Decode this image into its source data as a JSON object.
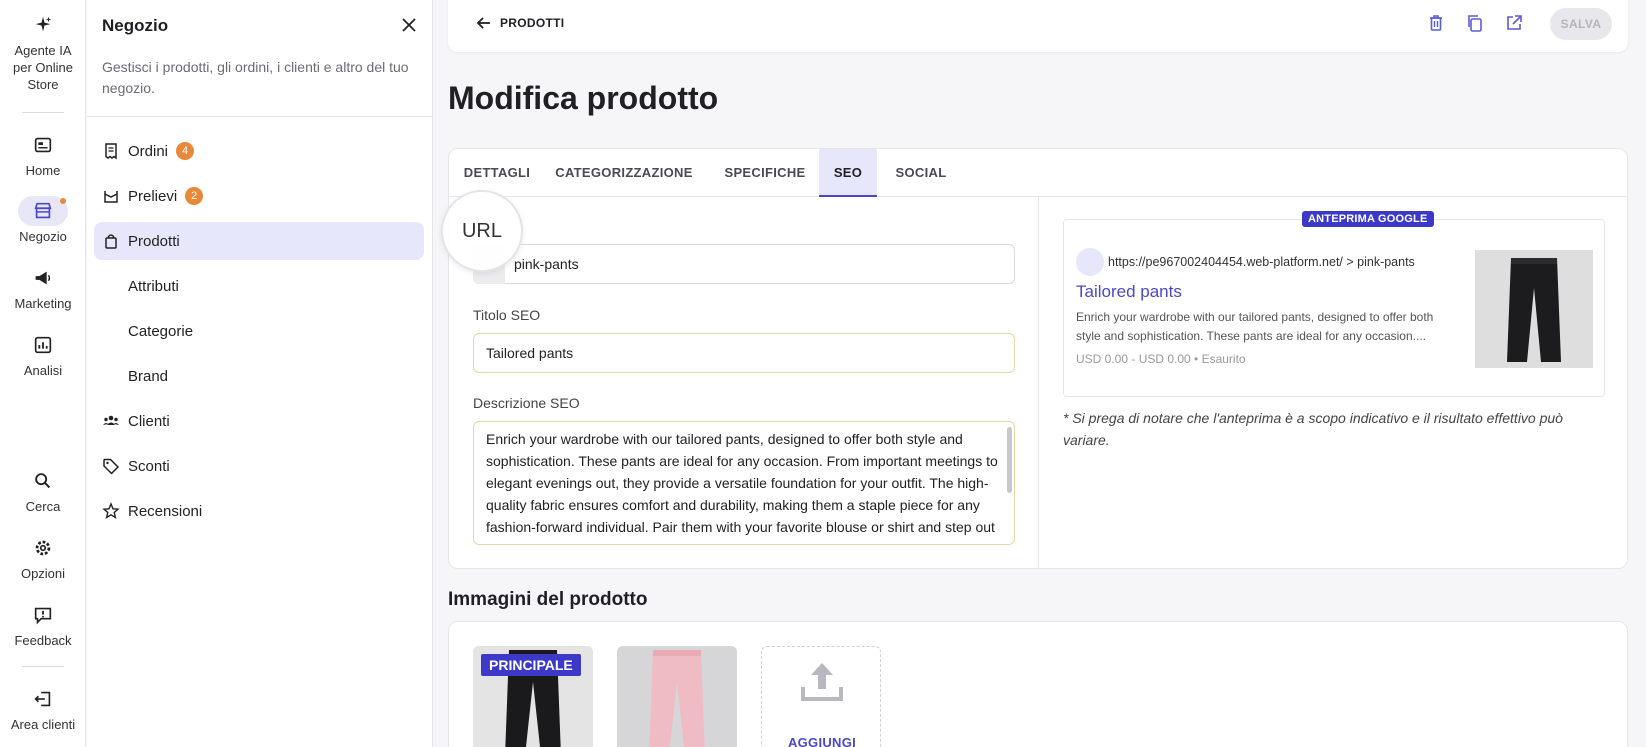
{
  "rail": {
    "agent": "Agente IA per Online Store",
    "home": "Home",
    "shop": "Negozio",
    "marketing": "Marketing",
    "analytics": "Analisi",
    "search": "Cerca",
    "options": "Opzioni",
    "feedback": "Feedback",
    "client_area": "Area clienti"
  },
  "panel": {
    "title": "Negozio",
    "description": "Gestisci i prodotti, gli ordini, i clienti e altro del tuo negozio.",
    "items": [
      {
        "label": "Ordini",
        "badge": "4"
      },
      {
        "label": "Prelievi",
        "badge": "2"
      },
      {
        "label": "Prodotti"
      },
      {
        "label": "Attributi"
      },
      {
        "label": "Categorie"
      },
      {
        "label": "Brand"
      },
      {
        "label": "Clienti"
      },
      {
        "label": "Sconti"
      },
      {
        "label": "Recensioni"
      }
    ]
  },
  "topbar": {
    "back_label": "PRODOTTI",
    "save_label": "SALVA"
  },
  "page": {
    "title": "Modifica prodotto"
  },
  "tabs": [
    "DETTAGLI",
    "CATEGORIZZAZIONE",
    "SPECIFICHE",
    "SEO",
    "SOCIAL"
  ],
  "seo": {
    "url_label": "URL",
    "url_value": "pink-pants",
    "title_label": "Titolo SEO",
    "title_value": "Tailored pants",
    "desc_label": "Descrizione SEO",
    "desc_value": "Enrich your wardrobe with our tailored pants, designed to offer both style and sophistication. These pants are ideal for any occasion. From important meetings to elegant evenings out, they provide a versatile foundation for your outfit. The high-quality fabric ensures comfort and durability, making them a staple piece for any fashion-forward individual. Pair them with your favorite blouse or shirt and step out with confidence. Make a lasting impression with these"
  },
  "preview": {
    "tag": "ANTEPRIMA GOOGLE",
    "url": "https://pe967002404454.web-platform.net/ > pink-pants",
    "title": "Tailored pants",
    "description": "Enrich your wardrobe with our tailored pants, designed to offer both style and sophistication. These pants are ideal for any occasion....",
    "price": "USD 0.00 - USD 0.00 • Esaurito",
    "note": "* Si prega di notare che l'anteprima è a scopo indicativo e il risultato effettivo può variare."
  },
  "images": {
    "section_title": "Immagini del prodotto",
    "main_tag": "PRINCIPALE",
    "add_label": "AGGIUNGI"
  },
  "colors": {
    "accent": "#4a48c8",
    "badge": "#e8893a",
    "active_bg": "#e7e7fb"
  }
}
